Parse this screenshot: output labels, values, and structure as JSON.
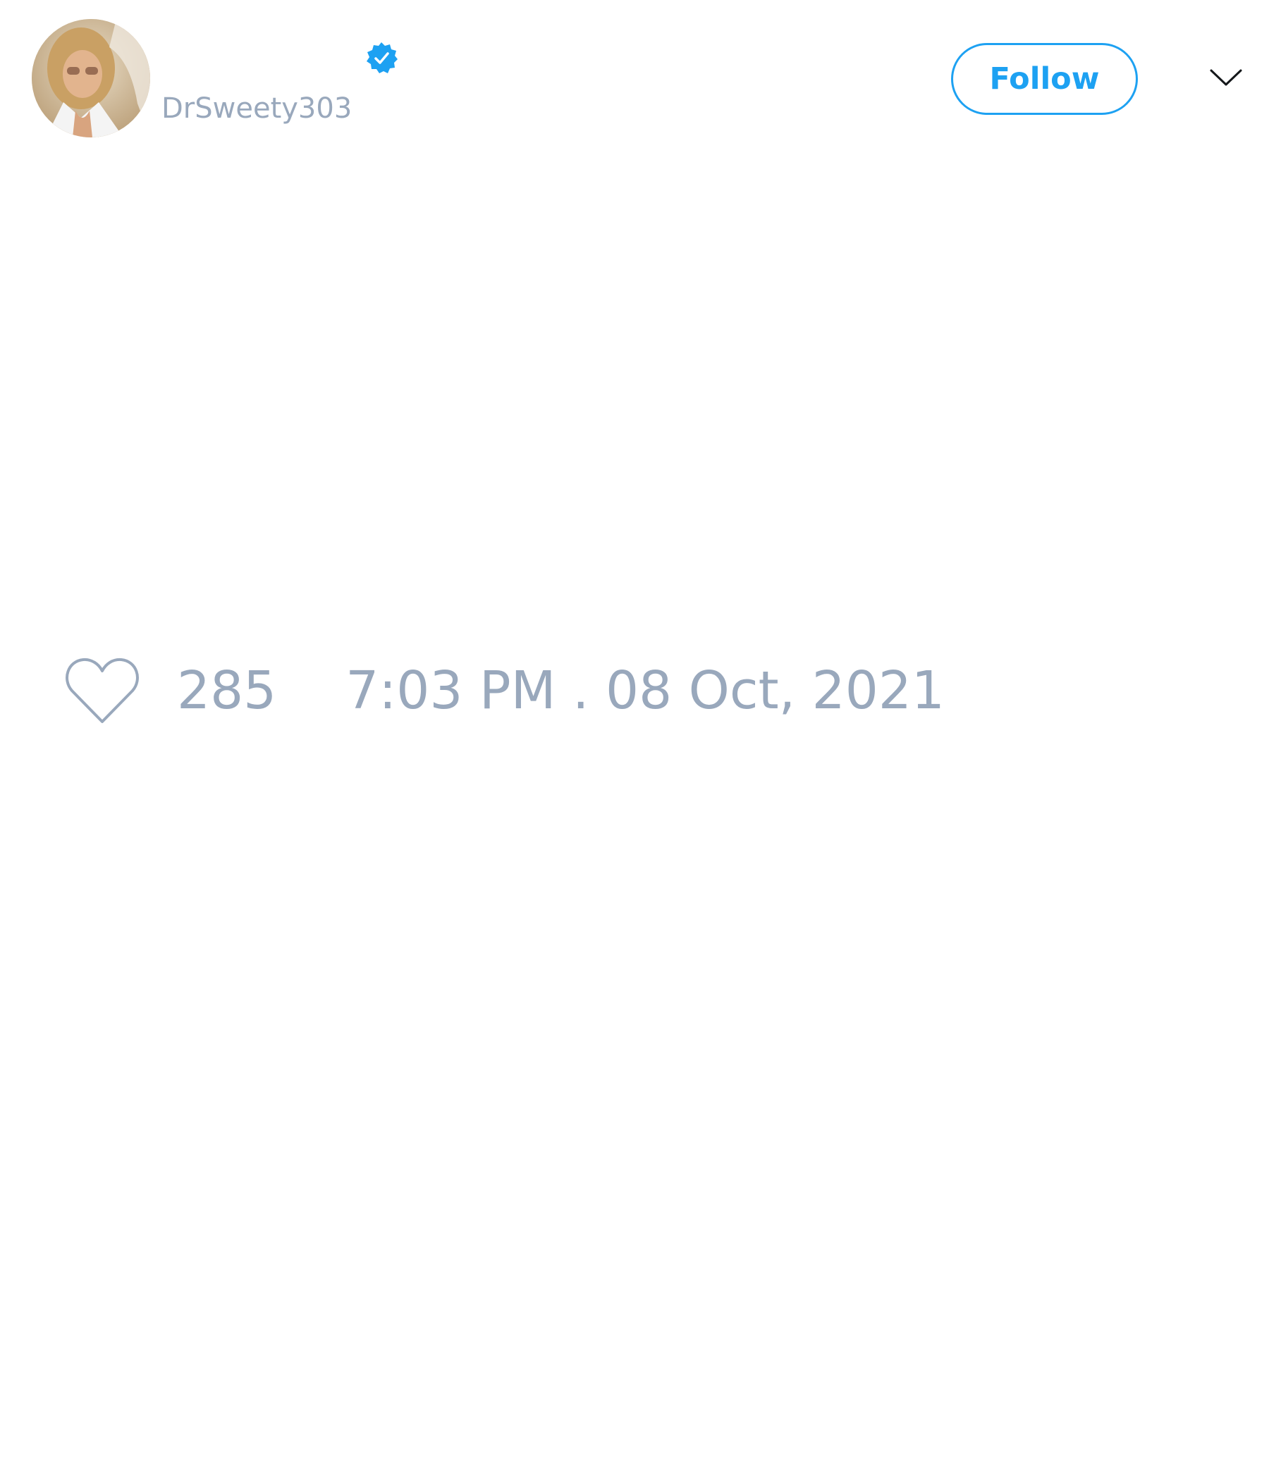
{
  "user": {
    "display_name": "",
    "handle": "DrSweety303",
    "verified": true
  },
  "actions": {
    "follow_label": "Follow"
  },
  "tweet": {
    "text": "",
    "like_count": "285",
    "timestamp": "7:03 PM . 08 Oct, 2021"
  },
  "colors": {
    "accent": "#1da1f2",
    "muted_text": "#99a8bc",
    "background": "#ffffff"
  },
  "icons": {
    "avatar": "profile-photo",
    "verified": "verified-badge-icon",
    "menu": "chevron-down-icon",
    "like": "heart-outline-icon"
  }
}
